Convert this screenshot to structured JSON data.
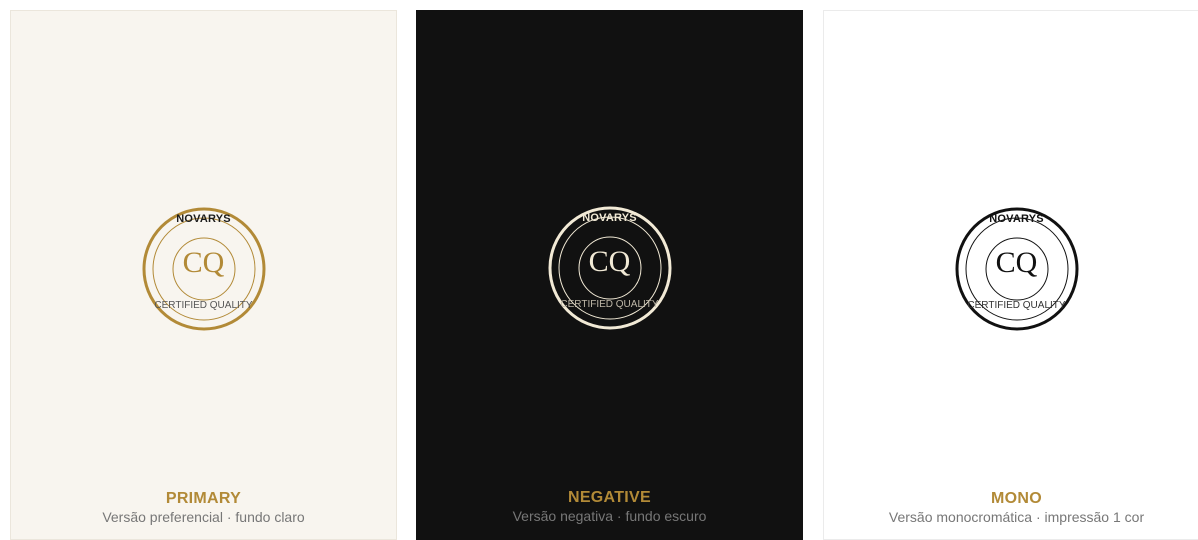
{
  "colors": {
    "gold": "#b28a37",
    "cream": "#f2ead6",
    "black": "#111111",
    "light_background": "#f8f5ef",
    "dark_background": "#111111",
    "white_background": "#ffffff",
    "description_text": "#777777"
  },
  "cards": [
    {
      "title": "PRIMARY",
      "description": "Versão preferencial · fundo claro",
      "seal": {
        "top_text": "NOVARYS",
        "monogram": "CQ",
        "bottom_text": "CERTIFIED QUALITY"
      }
    },
    {
      "title": "NEGATIVE",
      "description": "Versão negativa · fundo escuro",
      "seal": {
        "top_text": "NOVARYS",
        "monogram": "CQ",
        "bottom_text": "CERTIFIED QUALITY"
      }
    },
    {
      "title": "MONO",
      "description": "Versão monocromática · impressão 1 cor",
      "seal": {
        "top_text": "NOVARYS",
        "monogram": "CQ",
        "bottom_text": "CERTIFIED QUALITY"
      }
    }
  ]
}
